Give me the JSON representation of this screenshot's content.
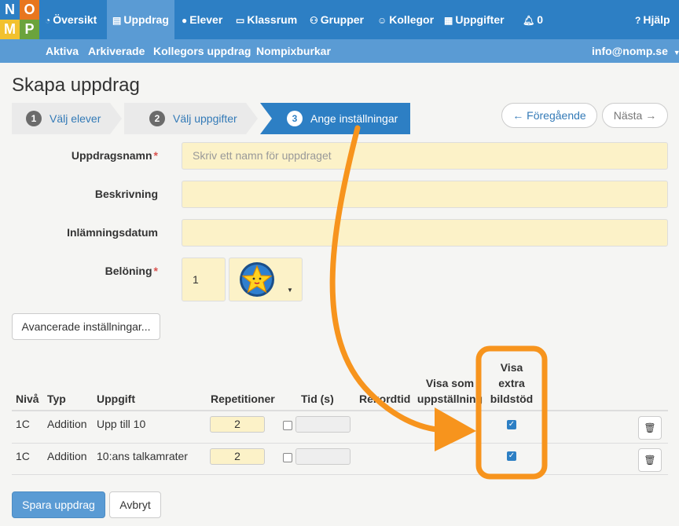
{
  "logo": {
    "letters": [
      "N",
      "O",
      "M",
      "P"
    ]
  },
  "nav": {
    "items": [
      {
        "label": "Översikt",
        "icon": "dashboard-icon"
      },
      {
        "label": "Uppdrag",
        "icon": "book-icon"
      },
      {
        "label": "Elever",
        "icon": "user-icon"
      },
      {
        "label": "Klassrum",
        "icon": "monitor-icon"
      },
      {
        "label": "Grupper",
        "icon": "group-icon"
      },
      {
        "label": "Kollegor",
        "icon": "smile-icon"
      },
      {
        "label": "Uppgifter",
        "icon": "grid-icon"
      }
    ],
    "notification_count": "0",
    "help_label": "Hjälp"
  },
  "subnav": {
    "items": [
      "Aktiva",
      "Arkiverade",
      "Kollegors uppdrag",
      "Nompixburkar"
    ],
    "account": "info@nomp.se"
  },
  "page": {
    "title": "Skapa uppdrag"
  },
  "wizard": {
    "steps": [
      {
        "num": "1",
        "label": "Välj elever"
      },
      {
        "num": "2",
        "label": "Välj uppgifter"
      },
      {
        "num": "3",
        "label": "Ange inställningar"
      }
    ],
    "prev_label": "← Föregående",
    "next_label": "Nästa →"
  },
  "form": {
    "name_label": "Uppdragsnamn",
    "name_placeholder": "Skriv ett namn för uppdraget",
    "description_label": "Beskrivning",
    "due_label": "Inlämningsdatum",
    "reward_label": "Belöning",
    "reward_value": "1",
    "advanced_label": "Avancerade inställningar..."
  },
  "table": {
    "headers": {
      "level": "Nivå",
      "type": "Typ",
      "task": "Uppgift",
      "repetitions": "Repetitioner",
      "time": "Tid (s)",
      "record": "Rekordtid",
      "setup_line1": "Visa som",
      "setup_line2": "uppställning",
      "extra_line1": "Visa",
      "extra_line2": "extra",
      "extra_line3": "bildstöd"
    },
    "rows": [
      {
        "level": "1C",
        "type": "Addition",
        "task": "Upp till 10",
        "repetitions": "2",
        "extra_support": true
      },
      {
        "level": "1C",
        "type": "Addition",
        "task": "10:ans talkamrater",
        "repetitions": "2",
        "extra_support": true
      }
    ]
  },
  "actions": {
    "save_label": "Spara uppdrag",
    "cancel_label": "Avbryt"
  },
  "annotation": {
    "color": "#f7941d"
  }
}
